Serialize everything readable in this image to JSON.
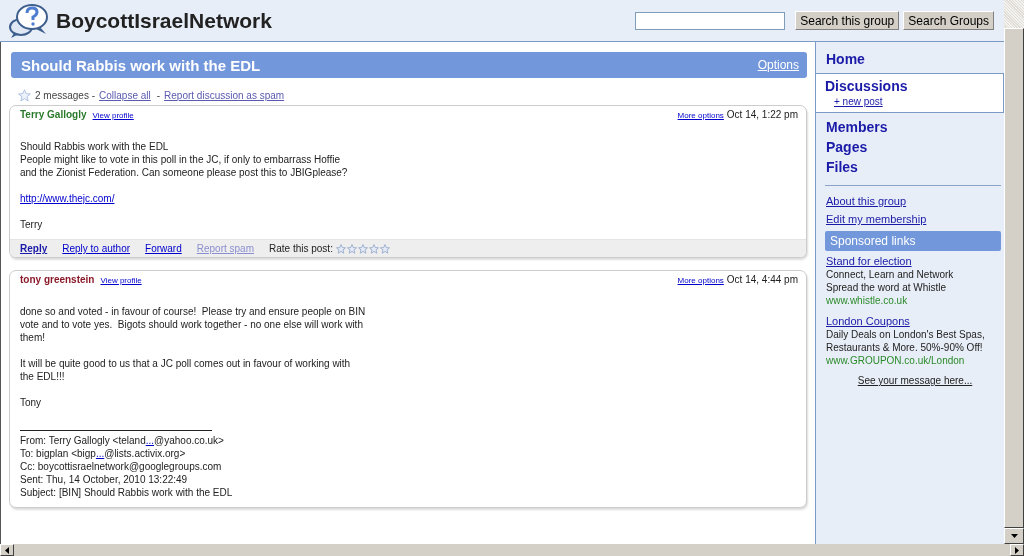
{
  "header": {
    "group_name": "BoycottIsraelNetwork",
    "buttons": [
      "Search this group",
      "Search Groups"
    ]
  },
  "thread": {
    "title": "Should Rabbis work with the EDL",
    "options_link": "Options",
    "starred": false,
    "summary": [
      {
        "kind": "text",
        "text": "2 messages -"
      },
      {
        "kind": "link",
        "text": "Collapse all"
      },
      {
        "kind": "text",
        "text": "-"
      },
      {
        "kind": "link",
        "text": "Report discussion as spam"
      }
    ],
    "messages": [
      {
        "author": "Terry Gallogly",
        "color": "#2a7a2a",
        "profile_link": "View profile",
        "more_options": "More options",
        "date": "Oct 14, 1:22 pm",
        "body": [
          {
            "kind": "text",
            "text": "Should Rabbis work with the EDL"
          },
          {
            "kind": "text",
            "text": "People might like to vote in this poll in the JC, if only to embarrass Hoffie"
          },
          {
            "kind": "text",
            "text": "and the Zionist Federation. Can someone please post this to JBIGplease?"
          },
          {
            "kind": "blank"
          },
          {
            "kind": "link",
            "text": "http://www.thejc.com/"
          },
          {
            "kind": "blank"
          },
          {
            "kind": "text",
            "text": "Terry"
          }
        ],
        "actions": [
          {
            "label": "Reply",
            "kind": "primary"
          },
          {
            "label": "Reply to author",
            "kind": "link"
          },
          {
            "label": "Forward",
            "kind": "link"
          },
          {
            "label": "Report spam",
            "kind": "muted"
          }
        ],
        "rating_label": "Rate this post:",
        "stars": 0
      },
      {
        "author": "tony greenstein",
        "color": "#8a1a2a",
        "profile_link": "View profile",
        "more_options": "More options",
        "date": "Oct 14, 4:44 pm",
        "body": [
          {
            "kind": "text",
            "text": "done so and voted - in favour of course!  Please try and ensure people on BIN"
          },
          {
            "kind": "text",
            "text": "vote and to vote yes.  Bigots should work together - no one else will work with"
          },
          {
            "kind": "text",
            "text": "them!"
          },
          {
            "kind": "blank"
          },
          {
            "kind": "text",
            "text": "It will be quite good to us that a JC poll comes out in favour of working with"
          },
          {
            "kind": "text",
            "text": "the EDL!!!"
          },
          {
            "kind": "blank"
          },
          {
            "kind": "text",
            "text": "Tony"
          },
          {
            "kind": "blank"
          },
          {
            "kind": "rule"
          },
          {
            "kind": "mixed",
            "parts": [
              {
                "text": "From: Terry Gallogly <teland"
              },
              {
                "link": "..."
              },
              {
                "text": "@yahoo.co.uk>"
              }
            ]
          },
          {
            "kind": "mixed",
            "parts": [
              {
                "text": "To: bigplan <bigp"
              },
              {
                "link": "..."
              },
              {
                "text": "@lists.activix.org>"
              }
            ]
          },
          {
            "kind": "text",
            "text": "Cc: boycottisraelnetwork@googlegroups.com"
          },
          {
            "kind": "text",
            "text": "Sent: Thu, 14 October, 2010 13:22:49"
          },
          {
            "kind": "text",
            "text": "Subject: [BIN] Should Rabbis work with the EDL"
          }
        ]
      }
    ]
  },
  "sidebar": {
    "nav": [
      {
        "label": "Home",
        "selected": false
      },
      {
        "label": "Discussions",
        "selected": true,
        "sub_link": "+ new post"
      },
      {
        "label": "Members",
        "selected": false
      },
      {
        "label": "Pages",
        "selected": false
      },
      {
        "label": "Files",
        "selected": false
      }
    ],
    "links": [
      "About this group",
      "Edit my membership"
    ],
    "sponsored": {
      "title": "Sponsored links",
      "ads": [
        {
          "title": "Stand for election",
          "lines": [
            "Connect, Learn and Network",
            "Spread the word at Whistle"
          ],
          "url": "www.whistle.co.uk"
        },
        {
          "title": "London Coupons",
          "lines": [
            "Daily Deals on London's Best Spas,",
            "Restaurants & More. 50%-90% Off!"
          ],
          "url": "www.GROUPON.co.uk/London"
        }
      ],
      "more": "See your message here..."
    }
  }
}
